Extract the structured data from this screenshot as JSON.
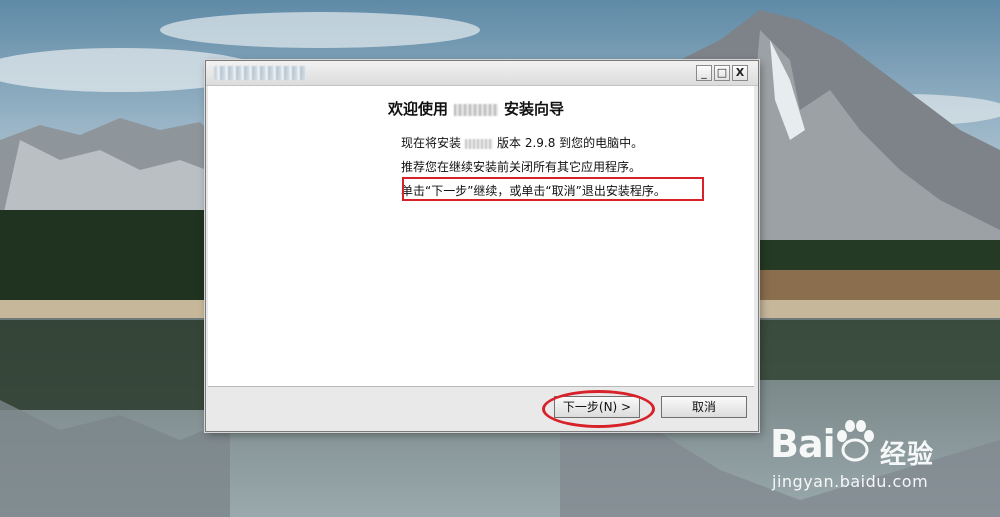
{
  "wallpaper": {
    "description_icon": "mountain-lake-icon"
  },
  "window": {
    "title_blurred": "",
    "controls": {
      "minimize": "_",
      "maximize": "□",
      "close": "X"
    }
  },
  "wizard": {
    "heading_prefix": "欢迎使用",
    "heading_suffix": "安装向导",
    "line1_prefix": "现在将安装",
    "line1_suffix": "版本 2.9.8 到您的电脑中。",
    "line2": "推荐您在继续安装前关闭所有其它应用程序。",
    "line3": "单击“下一步”继续，或单击“取消”退出安装程序。"
  },
  "buttons": {
    "next": "下一步(N) >",
    "cancel": "取消"
  },
  "colors": {
    "annotation_red": "#d8222a",
    "dialog_bg": "#e9e9e9"
  },
  "watermark": {
    "brand": "Bai",
    "cn": "经验",
    "url": "jingyan.baidu.com"
  }
}
